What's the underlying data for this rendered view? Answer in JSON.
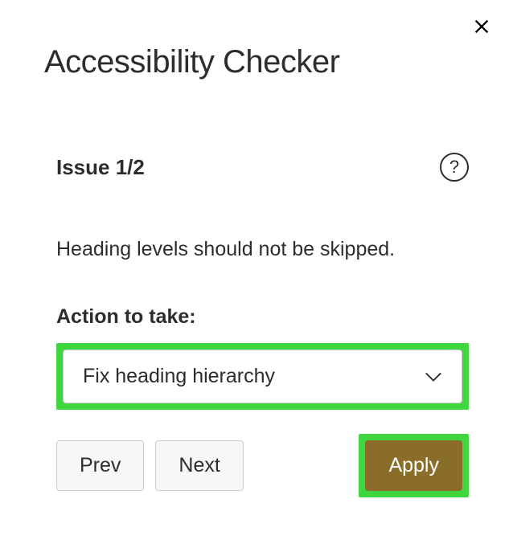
{
  "title": "Accessibility Checker",
  "issue": {
    "label": "Issue 1/2",
    "description": "Heading levels should not be skipped."
  },
  "action": {
    "label": "Action to take:",
    "selected": "Fix heading hierarchy"
  },
  "buttons": {
    "prev": "Prev",
    "next": "Next",
    "apply": "Apply"
  },
  "help_glyph": "?"
}
